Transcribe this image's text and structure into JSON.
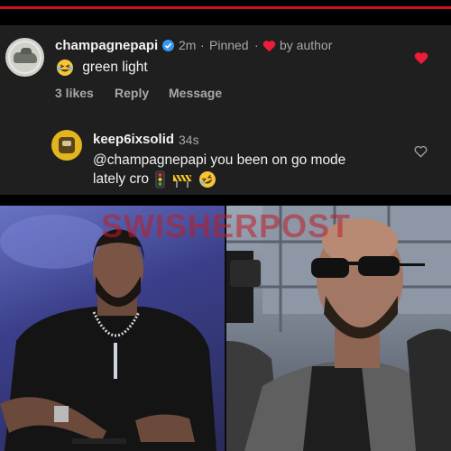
{
  "comment": {
    "username": "champagnepapi",
    "time": "2m",
    "separator": "·",
    "pinned": "Pinned",
    "by_author": "by author",
    "text": "green light",
    "likes": "3 likes",
    "reply_label": "Reply",
    "message_label": "Message"
  },
  "reply": {
    "username": "keep6ixsolid",
    "time": "34s",
    "text_line1": "@champagnepapi you been on go mode",
    "text_line2": "lately cro"
  },
  "photo": {
    "watermark": "SWISHERPOST"
  },
  "colors": {
    "panel_bg": "#1f1f1f",
    "red_heart": "#ed1c3a",
    "verified": "#3897f0",
    "muted_text": "#a8a8a8",
    "brand_red_line": "#d0141b"
  },
  "icons": {
    "verified": "verified-badge-icon",
    "heart_author": "red-heart-icon",
    "like": "heart-like-icon",
    "reply_like": "heart-outline-icon"
  }
}
